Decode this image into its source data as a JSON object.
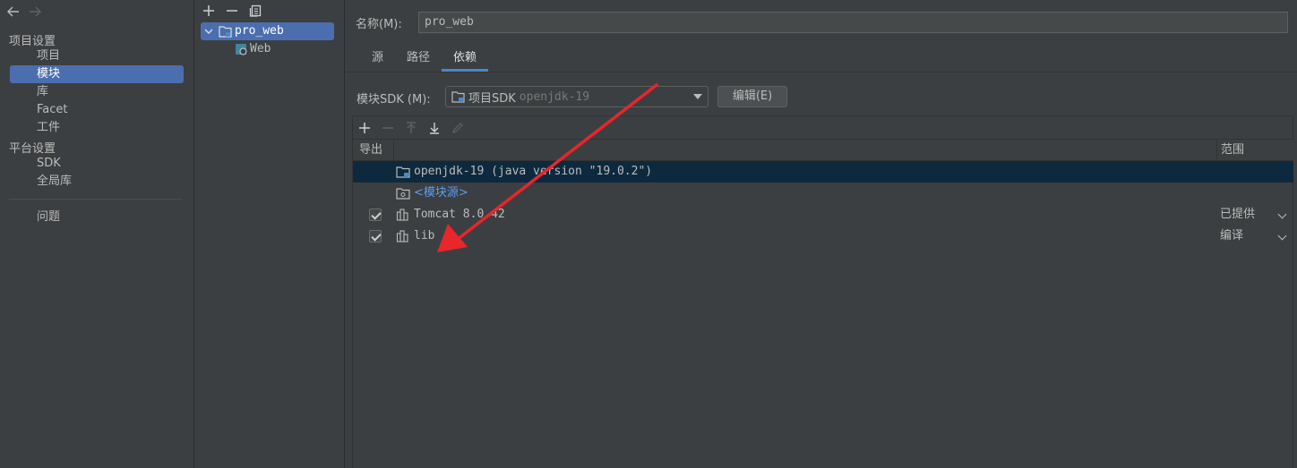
{
  "nav": {
    "back_icon": "arrow-left-icon",
    "forward_icon": "arrow-right-icon",
    "project_settings_header": "项目设置",
    "project_items": [
      "项目",
      "模块",
      "库",
      "Facet",
      "工件"
    ],
    "platform_settings_header": "平台设置",
    "platform_items": [
      "SDK",
      "全局库"
    ],
    "problems": "问题",
    "selected": "模块"
  },
  "tree": {
    "toolbar_icons": [
      "add-icon",
      "remove-icon",
      "copy-icon"
    ],
    "module_name": "pro_web",
    "facet_name": "Web"
  },
  "module": {
    "name_label": "名称(M):",
    "name_value": "pro_web",
    "tabs": [
      "源",
      "路径",
      "依赖"
    ],
    "active_tab": "依赖",
    "sdk_label": "模块SDK (M):",
    "sdk_value": "项目SDK",
    "sdk_hint": "openjdk-19",
    "edit_button": "编辑(E)"
  },
  "dependencies": {
    "toolbar_icons": [
      "add-icon",
      "remove-icon",
      "move-up-icon",
      "move-down-icon",
      "edit-icon"
    ],
    "header_export": "导出",
    "header_scope": "范围",
    "rows": [
      {
        "name": "openjdk-19 (java version \"19.0.2\")",
        "checked": null,
        "scope": "",
        "icon": "jdk-folder-icon"
      },
      {
        "name": "<模块源>",
        "checked": null,
        "scope": "",
        "icon": "module-source-icon"
      },
      {
        "name": "Tomcat 8.0.42",
        "checked": true,
        "scope": "已提供",
        "icon": "library-icon"
      },
      {
        "name": "lib",
        "checked": true,
        "scope": "编译",
        "icon": "library-icon"
      }
    ]
  },
  "colors": {
    "background": "#3c3f41",
    "selection": "#4b6eaf",
    "row_selection": "#0d293e",
    "link": "#589df6",
    "annotation_arrow": "#e8262b"
  }
}
